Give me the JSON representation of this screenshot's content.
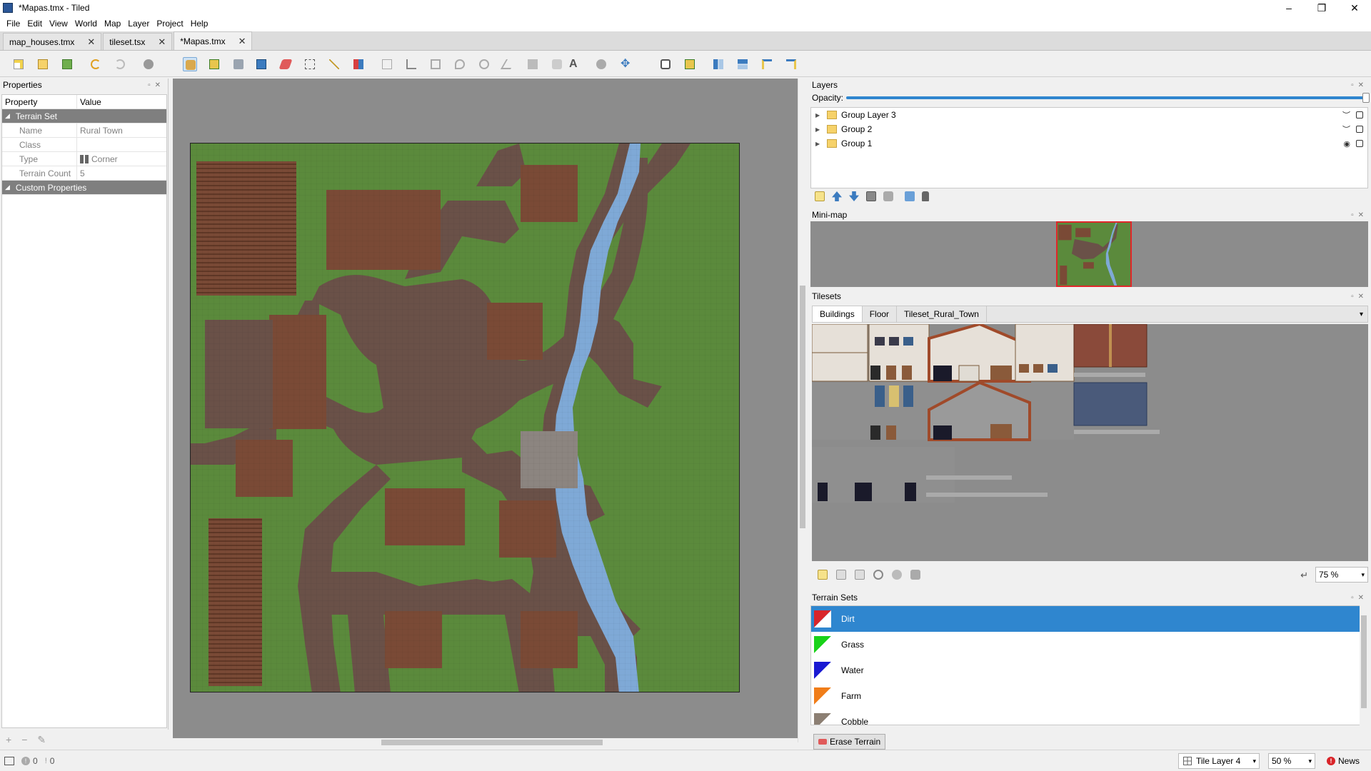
{
  "window": {
    "title": "*Mapas.tmx - Tiled",
    "controls": [
      "–",
      "❐",
      "✕"
    ]
  },
  "menu": [
    "File",
    "Edit",
    "View",
    "World",
    "Map",
    "Layer",
    "Project",
    "Help"
  ],
  "tabs": [
    {
      "label": "map_houses.tmx",
      "active": false
    },
    {
      "label": "tileset.tsx",
      "active": false
    },
    {
      "label": "*Mapas.tmx",
      "active": true
    }
  ],
  "properties": {
    "title": "Properties",
    "header": {
      "property": "Property",
      "value": "Value"
    },
    "group_terrain": "Terrain Set",
    "rows": [
      {
        "name": "Name",
        "value": "Rural Town"
      },
      {
        "name": "Class",
        "value": ""
      },
      {
        "name": "Type",
        "value": "Corner"
      },
      {
        "name": "Terrain Count",
        "value": "5"
      }
    ],
    "group_custom": "Custom Properties"
  },
  "layers": {
    "title": "Layers",
    "opacity_label": "Opacity:",
    "items": [
      {
        "name": "Group Layer 3"
      },
      {
        "name": "Group 2"
      },
      {
        "name": "Group 1"
      }
    ]
  },
  "minimap": {
    "title": "Mini-map"
  },
  "tilesets": {
    "title": "Tilesets",
    "tabs": [
      "Buildings",
      "Floor",
      "Tileset_Rural_Town"
    ],
    "zoom": "75 %"
  },
  "terrain_sets": {
    "title": "Terrain Sets",
    "items": [
      {
        "name": "Dirt",
        "color": "#d9252a",
        "selected": true
      },
      {
        "name": "Grass",
        "color": "#19d219",
        "selected": false
      },
      {
        "name": "Water",
        "color": "#1919d2",
        "selected": false
      },
      {
        "name": "Farm",
        "color": "#f07d19",
        "selected": false
      },
      {
        "name": "Cobble",
        "color": "#8c7f73",
        "selected": false
      }
    ],
    "erase_label": "Erase Terrain"
  },
  "status": {
    "errors": "0",
    "warnings": "0",
    "layer": "Tile Layer 4",
    "zoom": "50 %",
    "news": "News"
  },
  "colors": {
    "grass": "#5b8a3c",
    "dirt": "#6a5148",
    "farm": "#7a4a36",
    "water": "#7fa9d6",
    "cobble": "#8c8580",
    "selection": "#2f86cf"
  }
}
